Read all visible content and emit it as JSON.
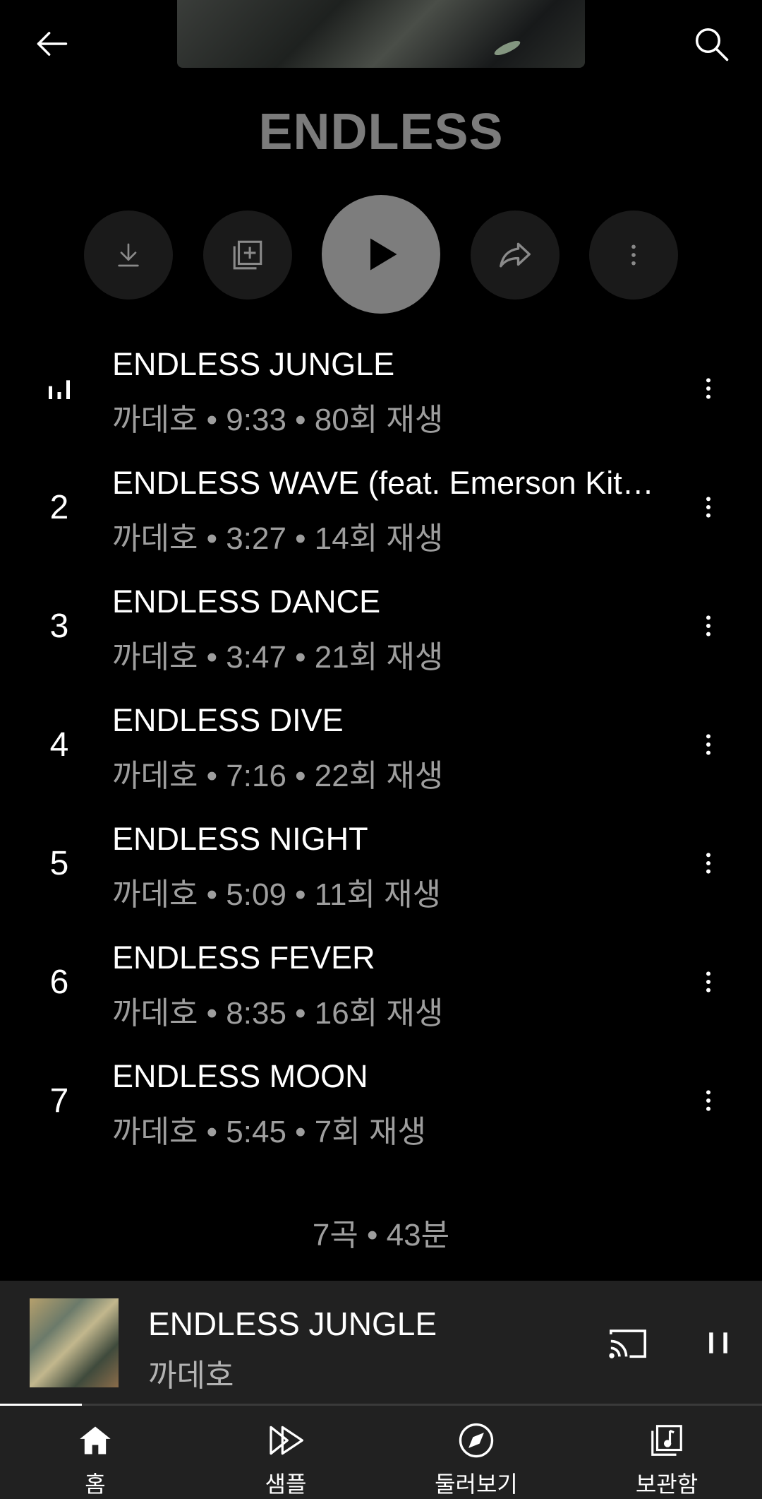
{
  "header": {
    "album_title": "ENDLESS"
  },
  "icons": {
    "back": "arrow-left-icon",
    "search": "search-icon",
    "download": "download-icon",
    "save": "add-to-library-icon",
    "play": "play-icon",
    "share": "share-icon",
    "more": "more-vert-icon",
    "now_playing": "equalizer-icon",
    "cast": "cast-icon",
    "pause": "pause-icon"
  },
  "tracks": [
    {
      "number": "",
      "playing": true,
      "title": "ENDLESS JUNGLE",
      "meta": "까데호 • 9:33 • 80회 재생"
    },
    {
      "number": "2",
      "playing": false,
      "title": "ENDLESS WAVE (feat. Emerson Kit…",
      "meta": "까데호 • 3:27 • 14회 재생"
    },
    {
      "number": "3",
      "playing": false,
      "title": "ENDLESS DANCE",
      "meta": "까데호 • 3:47 • 21회 재생"
    },
    {
      "number": "4",
      "playing": false,
      "title": "ENDLESS DIVE",
      "meta": "까데호 • 7:16 • 22회 재생"
    },
    {
      "number": "5",
      "playing": false,
      "title": "ENDLESS NIGHT",
      "meta": "까데호 • 5:09 • 11회 재생"
    },
    {
      "number": "6",
      "playing": false,
      "title": "ENDLESS FEVER",
      "meta": "까데호 • 8:35 • 16회 재생"
    },
    {
      "number": "7",
      "playing": false,
      "title": "ENDLESS MOON",
      "meta": "까데호 • 5:45 • 7회 재생"
    }
  ],
  "summary": "7곡 • 43분",
  "mini_player": {
    "title": "ENDLESS JUNGLE",
    "artist": "까데호",
    "progress": 0.107
  },
  "bottom_nav": [
    {
      "label": "홈",
      "icon": "home-icon",
      "active": true
    },
    {
      "label": "샘플",
      "icon": "samples-icon",
      "active": false
    },
    {
      "label": "둘러보기",
      "icon": "explore-icon",
      "active": false
    },
    {
      "label": "보관함",
      "icon": "library-icon",
      "active": false
    }
  ]
}
